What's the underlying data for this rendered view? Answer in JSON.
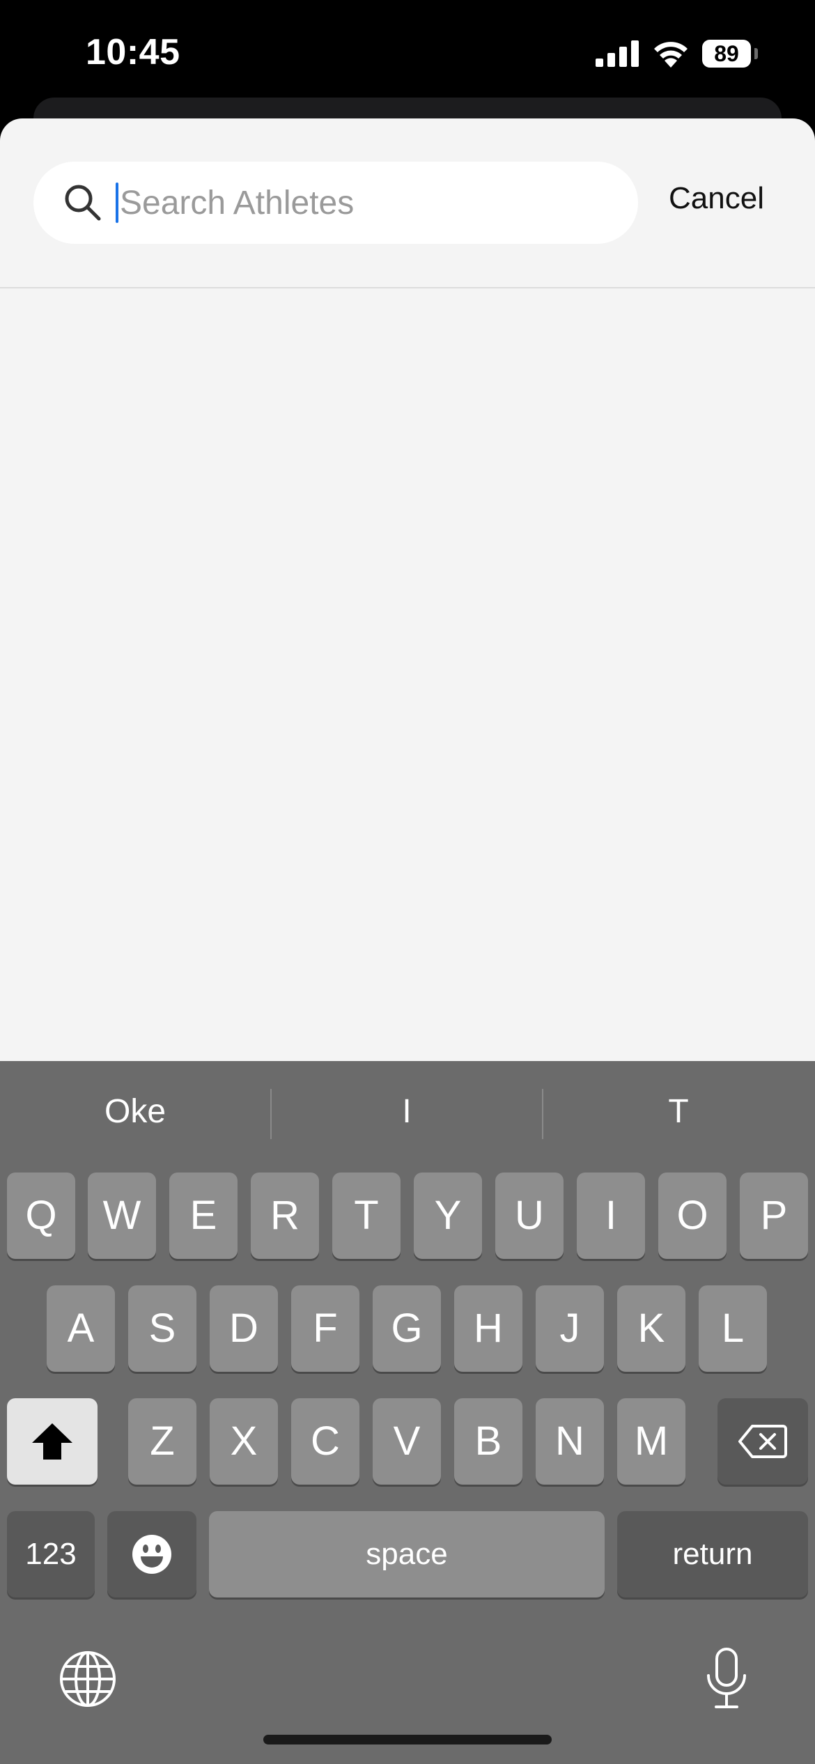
{
  "status_bar": {
    "time": "10:45",
    "battery": "89"
  },
  "search": {
    "placeholder": "Search Athletes",
    "value": ""
  },
  "header": {
    "cancel_label": "Cancel"
  },
  "keyboard": {
    "suggestions": [
      "Oke",
      "I",
      "T"
    ],
    "row1": [
      "Q",
      "W",
      "E",
      "R",
      "T",
      "Y",
      "U",
      "I",
      "O",
      "P"
    ],
    "row2": [
      "A",
      "S",
      "D",
      "F",
      "G",
      "H",
      "J",
      "K",
      "L"
    ],
    "row3": [
      "Z",
      "X",
      "C",
      "V",
      "B",
      "N",
      "M"
    ],
    "numbers_label": "123",
    "space_label": "space",
    "return_label": "return"
  },
  "icons": [
    "search-icon",
    "shift-icon",
    "delete-icon",
    "emoji-icon",
    "globe-icon",
    "microphone-icon",
    "cellular-signal-icon",
    "wifi-icon",
    "battery-icon"
  ]
}
